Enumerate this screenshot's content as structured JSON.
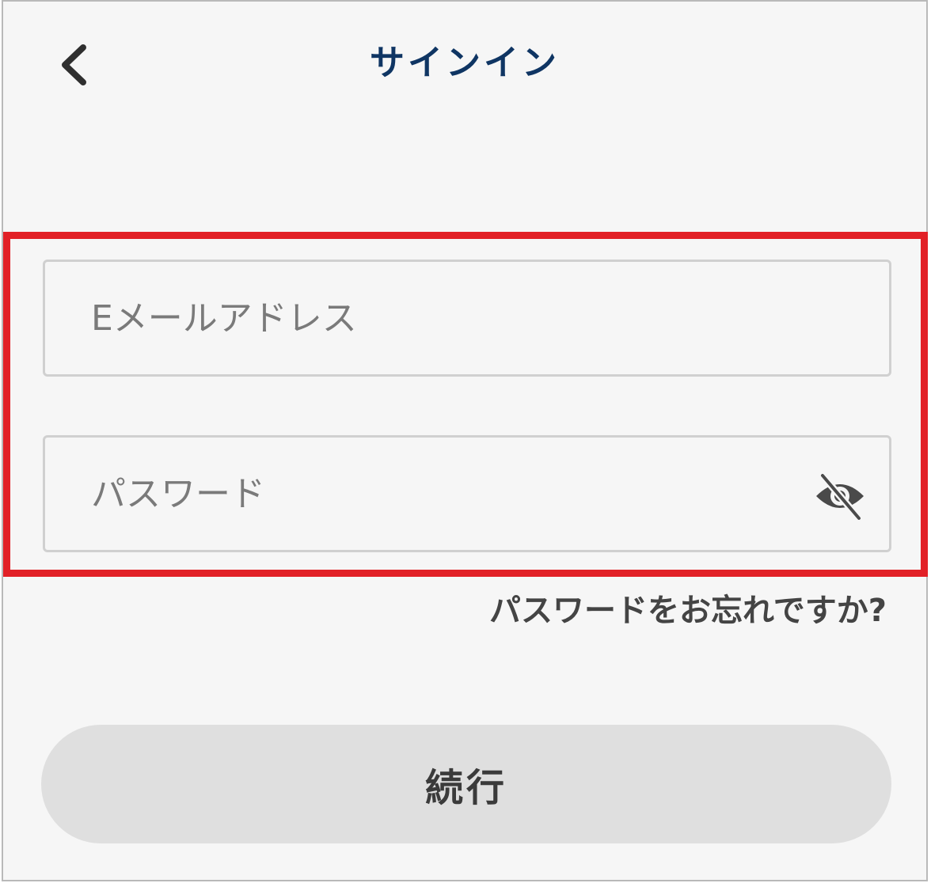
{
  "header": {
    "title": "サインイン",
    "back_icon": "chevron-left-icon"
  },
  "form": {
    "email": {
      "value": "",
      "placeholder": "Eメールアドレス"
    },
    "password": {
      "value": "",
      "placeholder": "パスワード",
      "visibility_icon": "eye-slash-icon"
    }
  },
  "links": {
    "forgot_password": "パスワードをお忘れですか?"
  },
  "actions": {
    "continue_label": "続行"
  },
  "colors": {
    "title": "#0f3563",
    "highlight_border": "#e22127",
    "button_background": "#dfdfdf",
    "background": "#f6f6f6"
  }
}
